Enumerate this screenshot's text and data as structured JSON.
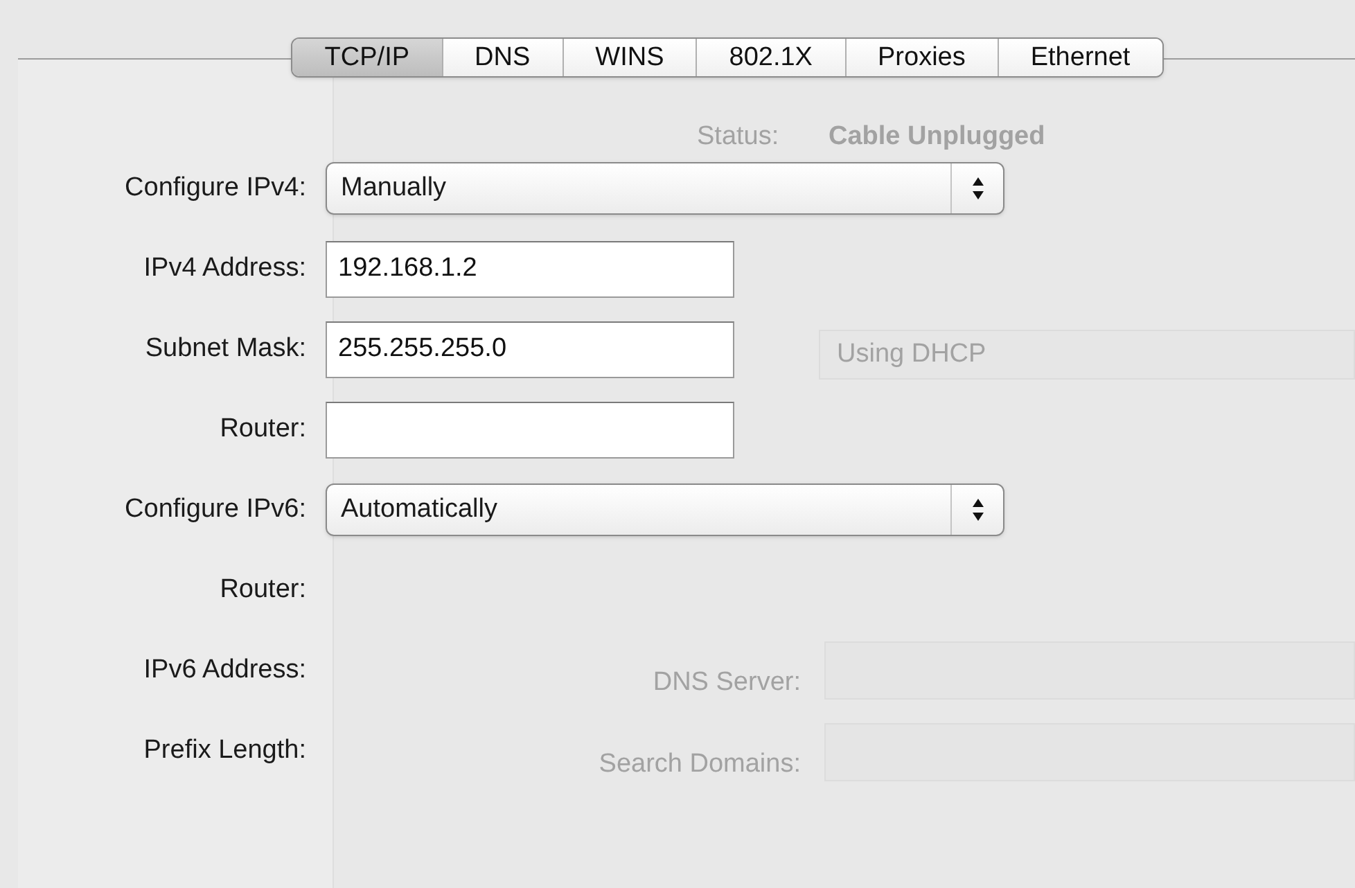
{
  "tabs": [
    {
      "label": "TCP/IP",
      "selected": true
    },
    {
      "label": "DNS",
      "selected": false
    },
    {
      "label": "WINS",
      "selected": false
    },
    {
      "label": "802.1X",
      "selected": false
    },
    {
      "label": "Proxies",
      "selected": false
    },
    {
      "label": "Ethernet",
      "selected": false
    }
  ],
  "rows": [
    {
      "kind": "popup",
      "label": "Configure IPv4:",
      "value": "Manually"
    },
    {
      "kind": "field",
      "label": "IPv4 Address:",
      "value": "192.168.1.2"
    },
    {
      "kind": "field",
      "label": "Subnet Mask:",
      "value": "255.255.255.0"
    },
    {
      "kind": "field",
      "label": "Router:",
      "value": ""
    },
    {
      "kind": "popup",
      "label": "Configure IPv6:",
      "value": "Automatically"
    },
    {
      "kind": "text",
      "label": "Router:"
    },
    {
      "kind": "text",
      "label": "IPv6 Address:"
    },
    {
      "kind": "text",
      "label": "Prefix Length:"
    }
  ],
  "background_window": {
    "status_label": "Status:",
    "status_value": "Cable Unplugged",
    "config_value": "Using DHCP",
    "dns_label": "DNS Server:",
    "search_label": "Search Domains:"
  }
}
